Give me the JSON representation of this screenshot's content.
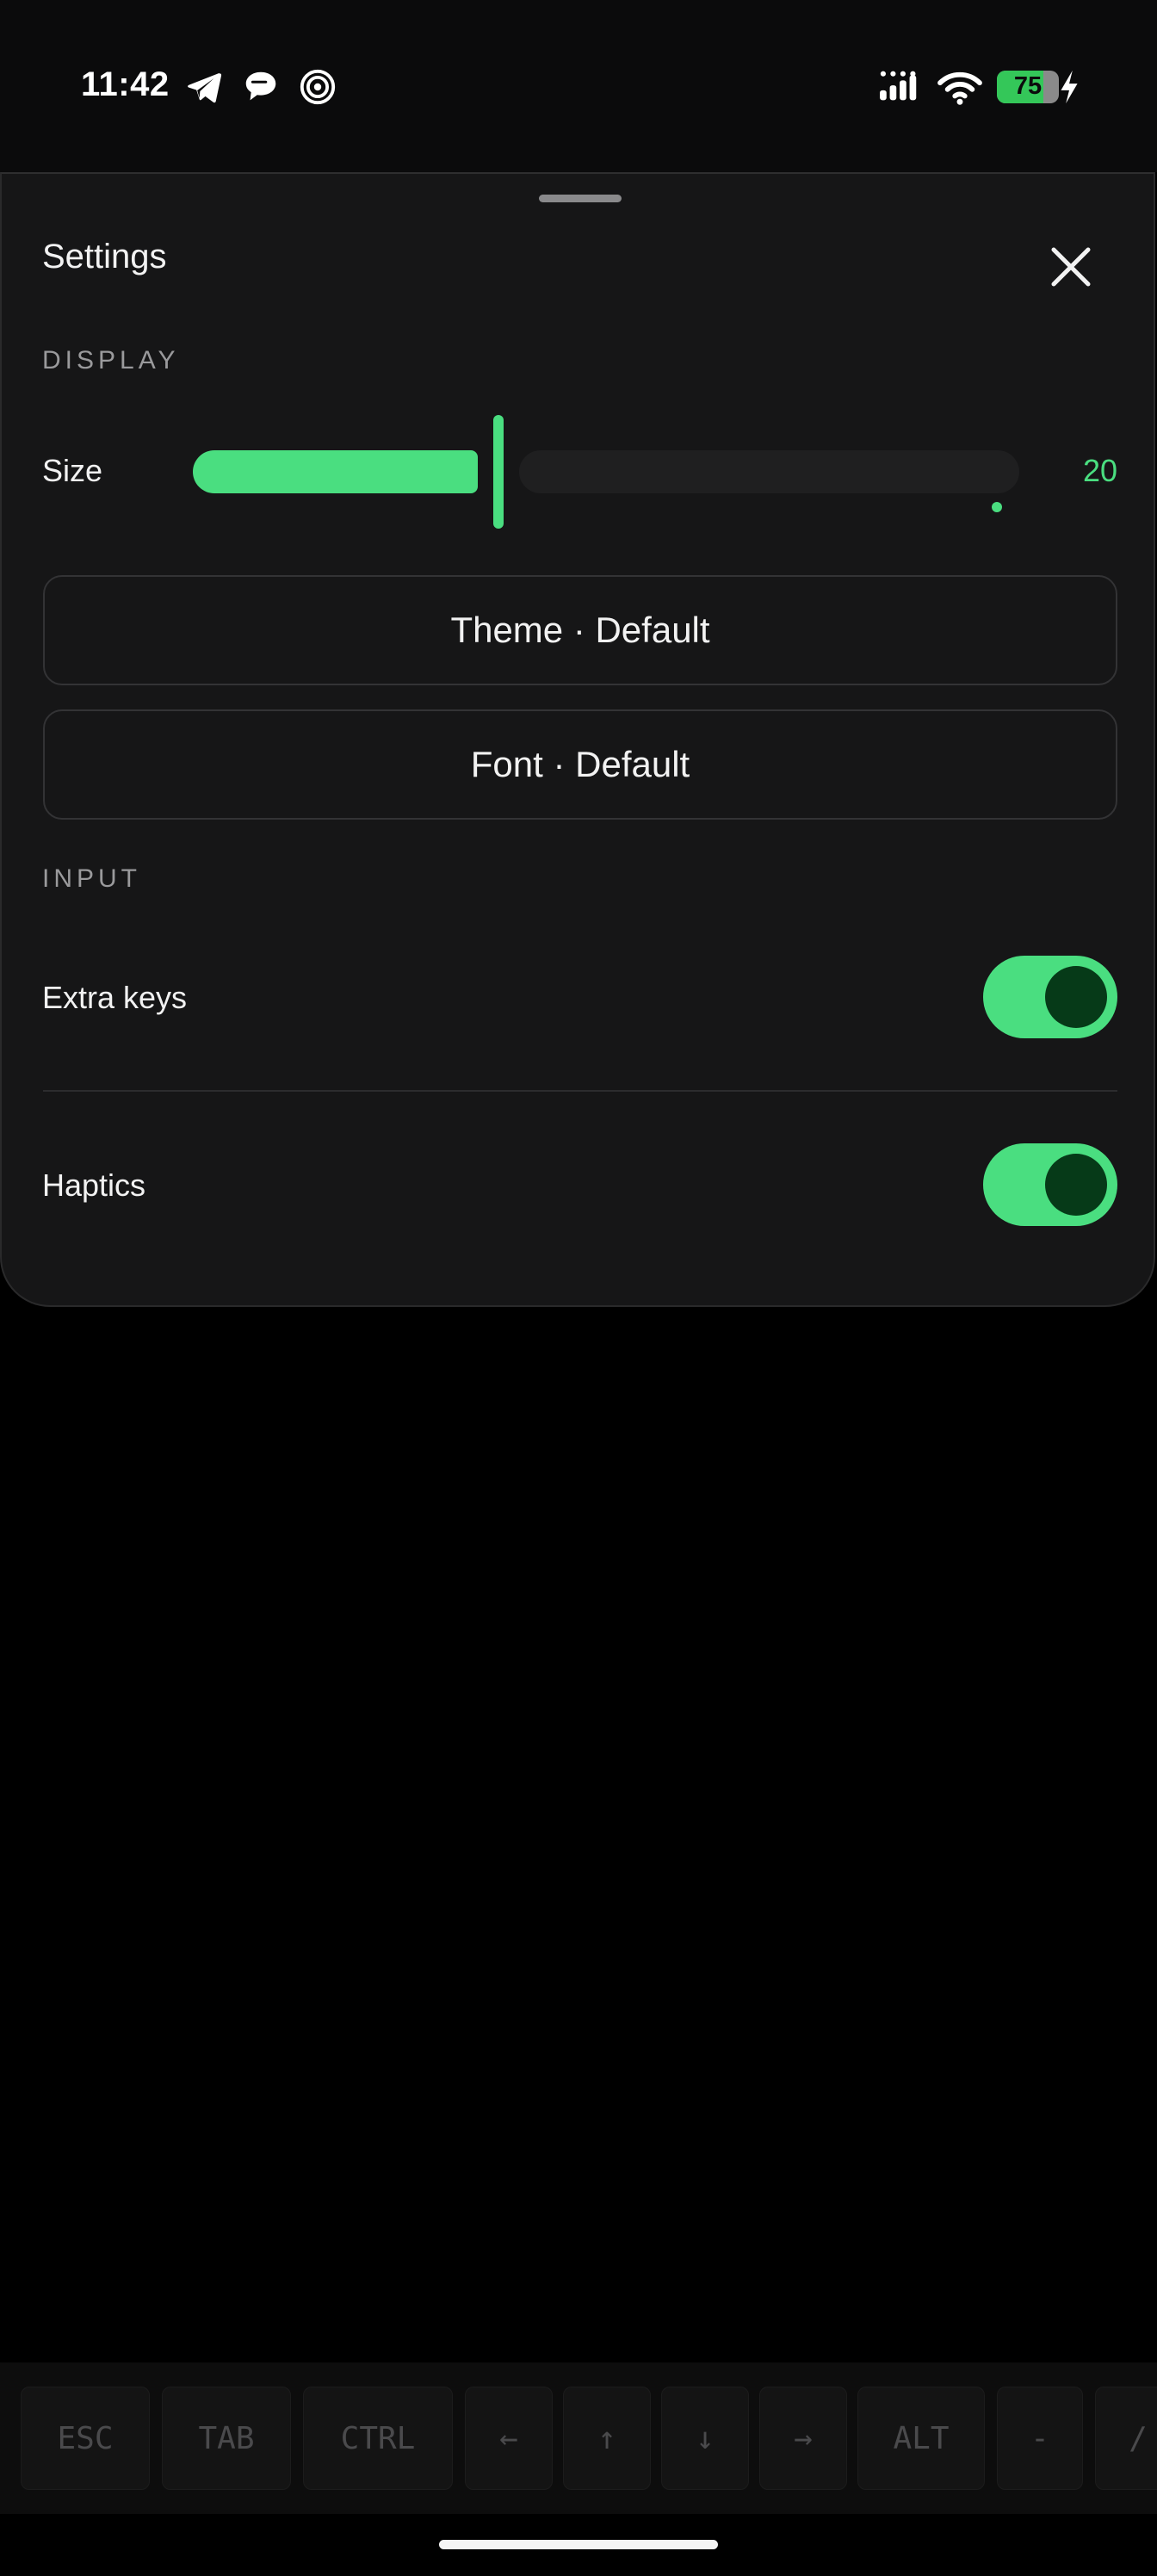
{
  "status_bar": {
    "time": "11:42",
    "left_icons": [
      "telegram-icon",
      "chat-bubble-icon",
      "target-icon"
    ],
    "right_icons": [
      "signal-icon",
      "wifi-icon",
      "battery-icon",
      "charging-bolt-icon"
    ],
    "battery_percent": "75",
    "battery_level": 0.75
  },
  "sheet": {
    "title": "Settings",
    "close_icon": "close-icon",
    "display": {
      "section_label": "DISPLAY",
      "size_label": "Size",
      "size_value": "20",
      "size_fill_fraction": 0.37,
      "theme_button": "Theme · Default",
      "font_button": "Font · Default"
    },
    "input": {
      "section_label": "INPUT",
      "extra_keys_label": "Extra keys",
      "extra_keys_on": true,
      "haptics_label": "Haptics",
      "haptics_on": true
    }
  },
  "extra_keys": [
    "ESC",
    "TAB",
    "CTRL",
    "←",
    "↑",
    "↓",
    "→",
    "ALT",
    "-",
    "/"
  ],
  "colors": {
    "accent": "#4ade80",
    "toggle_knob": "#063a18",
    "sheet_bg": "#161617",
    "page_bg": "#000000"
  }
}
